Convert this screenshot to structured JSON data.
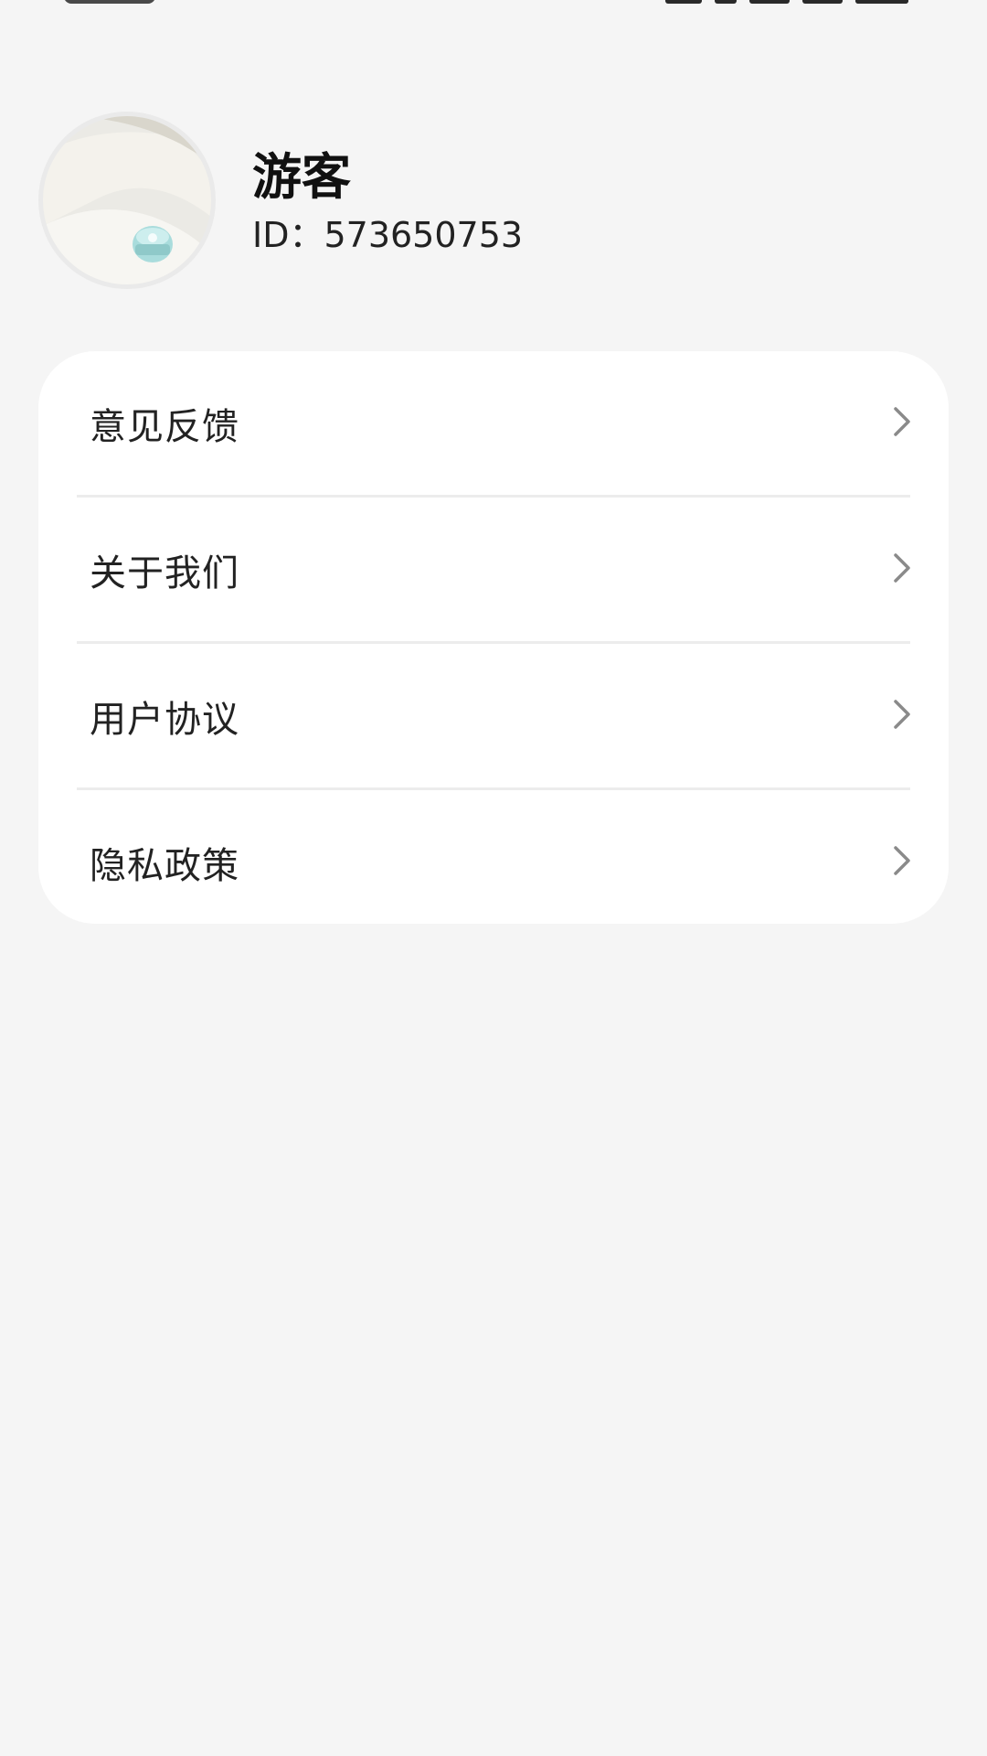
{
  "profile": {
    "username": "游客",
    "id_text": "ID：573650753"
  },
  "menu": {
    "items": [
      {
        "label": "意见反馈"
      },
      {
        "label": "关于我们"
      },
      {
        "label": "用户协议"
      },
      {
        "label": "隐私政策"
      }
    ]
  },
  "icons": {
    "chevron": "chevron-right-icon"
  },
  "colors": {
    "background": "#f5f5f5",
    "card": "#ffffff",
    "divider": "#ececec",
    "chevron": "#8a8a8a"
  }
}
